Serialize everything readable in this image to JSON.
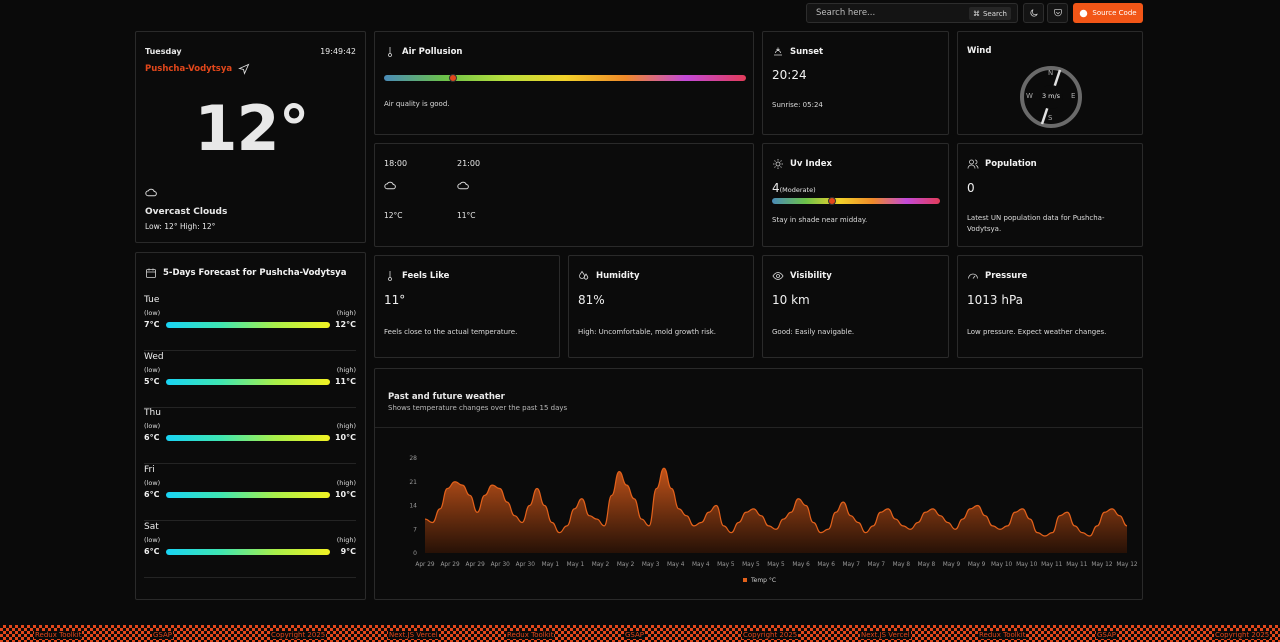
{
  "header": {
    "search_placeholder": "Search here...",
    "search_kbd": "Search",
    "source_btn": "Source Code"
  },
  "current": {
    "day": "Tuesday",
    "time": "19:49:42",
    "location": "Pushcha-Vodytsya",
    "temp": "12°",
    "condition": "Overcast Clouds",
    "lowhigh": "Low: 12°  High: 12°"
  },
  "air": {
    "title": "Air Pollusion",
    "desc": "Air quality is good.",
    "level": 0.19
  },
  "sunset": {
    "title": "Sunset",
    "time": "20:24",
    "sunrise": "Sunrise: 05:24"
  },
  "wind": {
    "title": "Wind",
    "speed": "3 m/s",
    "n": "N",
    "e": "E",
    "s": "S",
    "w": "W"
  },
  "hourly": [
    {
      "time": "18:00",
      "temp": "12°C"
    },
    {
      "time": "21:00",
      "temp": "11°C"
    }
  ],
  "uv": {
    "title": "Uv Index",
    "value": "4",
    "label": "(Moderate)",
    "desc": "Stay in shade near midday.",
    "level": 0.36
  },
  "population": {
    "title": "Population",
    "value": "0",
    "desc": "Latest UN population data for Pushcha-Vodytsya."
  },
  "feels": {
    "title": "Feels Like",
    "value": "11°",
    "desc": "Feels close to the actual temperature."
  },
  "humidity": {
    "title": "Humidity",
    "value": "81%",
    "desc": "High: Uncomfortable, mold growth risk."
  },
  "visibility": {
    "title": "Visibility",
    "value": "10 km",
    "desc": "Good: Easily navigable."
  },
  "pressure": {
    "title": "Pressure",
    "value": "1013 hPa",
    "desc": "Low pressure. Expect weather changes."
  },
  "forecast": {
    "title": "5-Days Forecast for Pushcha-Vodytsya",
    "low_label": "(low)",
    "high_label": "(high)",
    "days": [
      {
        "day": "Tue",
        "low": "7°C",
        "high": "12°C"
      },
      {
        "day": "Wed",
        "low": "5°C",
        "high": "11°C"
      },
      {
        "day": "Thu",
        "low": "6°C",
        "high": "10°C"
      },
      {
        "day": "Fri",
        "low": "6°C",
        "high": "10°C"
      },
      {
        "day": "Sat",
        "low": "6°C",
        "high": "9°C"
      }
    ]
  },
  "chart_header": {
    "title": "Past and future weather",
    "subtitle": "Shows temperature changes over the past 15 days"
  },
  "chart_data": {
    "type": "area",
    "ylim": [
      0,
      28
    ],
    "yticks": [
      0,
      7,
      14,
      21,
      28
    ],
    "x": [
      "Apr 29",
      "Apr 29",
      "Apr 29",
      "Apr 30",
      "Apr 30",
      "May 1",
      "May 1",
      "May 2",
      "May 2",
      "May 3",
      "May 4",
      "May 4",
      "May 5",
      "May 5",
      "May 5",
      "May 6",
      "May 6",
      "May 7",
      "May 7",
      "May 8",
      "May 8",
      "May 9",
      "May 9",
      "May 10",
      "May 10",
      "May 11",
      "May 11",
      "May 12",
      "May 12"
    ],
    "series": [
      {
        "name": "Temp °C",
        "color": "#e2611b",
        "values": [
          10,
          9,
          13,
          19,
          21,
          20,
          17,
          12,
          17,
          20,
          19,
          15,
          11,
          9,
          14,
          19,
          14,
          9,
          6,
          8,
          13,
          16,
          11,
          10,
          8,
          17,
          24,
          20,
          16,
          10,
          8,
          19,
          25,
          19,
          13,
          11,
          8,
          9,
          12,
          14,
          8,
          6,
          9,
          12,
          13,
          11,
          8,
          7,
          10,
          12,
          16,
          14,
          9,
          6,
          7,
          12,
          15,
          11,
          9,
          6,
          8,
          12,
          13,
          10,
          8,
          7,
          9,
          12,
          13,
          11,
          9,
          7,
          10,
          13,
          14,
          11,
          8,
          7,
          8,
          12,
          13,
          10,
          6,
          5,
          6,
          11,
          12,
          8,
          6,
          5,
          8,
          12,
          13,
          11,
          8
        ]
      }
    ],
    "legend": "bottom"
  },
  "footer": [
    "Redux Toolkit",
    "GSAP",
    "Copyright 2025",
    "Next.JS Vercel",
    "Redux Toolkit",
    "GSAP",
    "Copyright 2025",
    "Next.JS Vercel",
    "Redux Toolkit",
    "GSAP",
    "Copyright 2025"
  ]
}
